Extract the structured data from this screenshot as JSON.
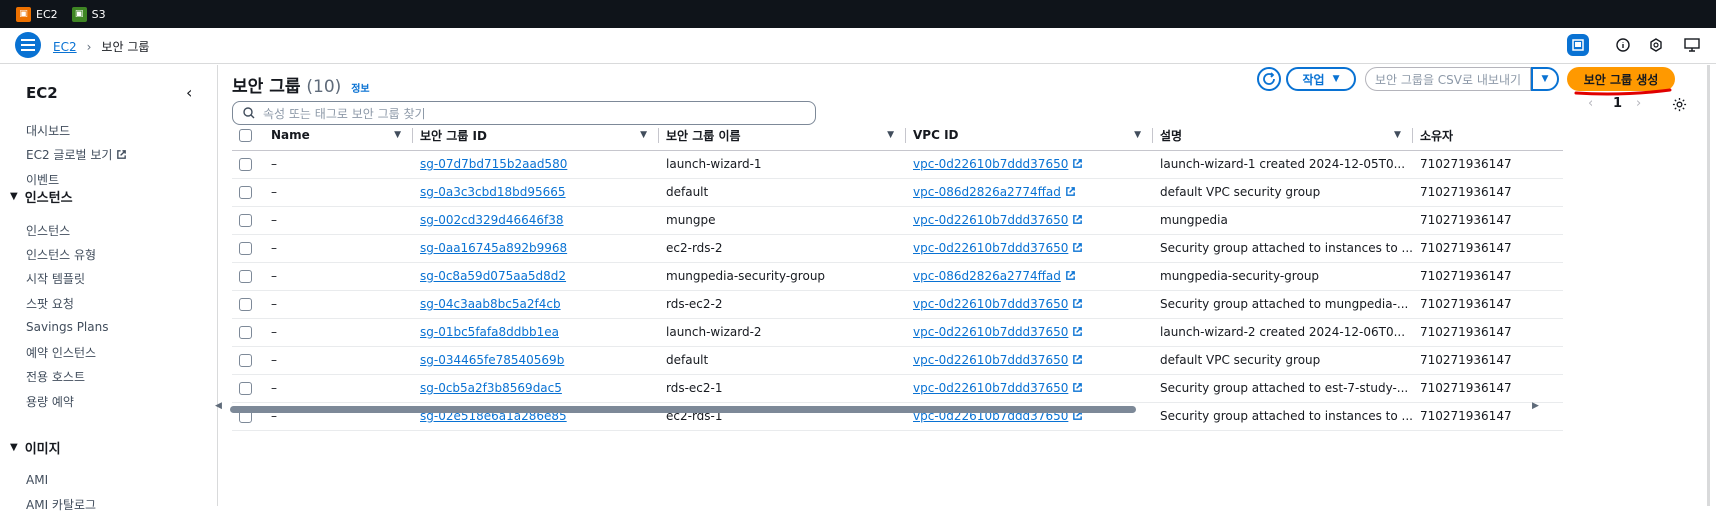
{
  "topbar": {
    "services": [
      {
        "label": "EC2",
        "color": "#ed7100",
        "icon": "ec2-icon"
      },
      {
        "label": "S3",
        "color": "#3f8624",
        "icon": "s3-icon"
      }
    ]
  },
  "breadcrumb": {
    "parent": "EC2",
    "current": "보안 그룹"
  },
  "sidebar": {
    "title": "EC2",
    "top_items": [
      "대시보드",
      "EC2 글로벌 보기",
      "이벤트"
    ],
    "section_instances": "인스턴스",
    "instance_items": [
      "인스턴스",
      "인스턴스 유형",
      "시작 템플릿",
      "스팟 요청",
      "Savings Plans",
      "예약 인스턴스",
      "전용 호스트",
      "용량 예약"
    ],
    "section_images": "이미지",
    "image_items": [
      "AMI",
      "AMI 카탈로그"
    ]
  },
  "page": {
    "title": "보안 그룹",
    "count": "(10)",
    "info": "정보",
    "actions_label": "작업",
    "export_label": "보안 그룹을 CSV로 내보내기",
    "create_label": "보안 그룹 생성",
    "search_placeholder": "속성 또는 태그로 보안 그룹 찾기",
    "page_number": "1"
  },
  "table": {
    "headers": [
      "Name",
      "보안 그룹 ID",
      "보안 그룹 이름",
      "VPC ID",
      "설명",
      "소유자"
    ],
    "rows": [
      {
        "name": "–",
        "id": "sg-07d7bd715b2aad580",
        "sgname": "launch-wizard-1",
        "vpc": "vpc-0d22610b7ddd37650",
        "desc": "launch-wizard-1 created 2024-12-05T0...",
        "owner": "710271936147"
      },
      {
        "name": "–",
        "id": "sg-0a3c3cbd18bd95665",
        "sgname": "default",
        "vpc": "vpc-086d2826a2774ffad",
        "desc": "default VPC security group",
        "owner": "710271936147"
      },
      {
        "name": "–",
        "id": "sg-002cd329d46646f38",
        "sgname": "mungpe",
        "vpc": "vpc-0d22610b7ddd37650",
        "desc": "mungpedia",
        "owner": "710271936147"
      },
      {
        "name": "–",
        "id": "sg-0aa16745a892b9968",
        "sgname": "ec2-rds-2",
        "vpc": "vpc-0d22610b7ddd37650",
        "desc": "Security group attached to instances to ...",
        "owner": "710271936147"
      },
      {
        "name": "–",
        "id": "sg-0c8a59d075aa5d8d2",
        "sgname": "mungpedia-security-group",
        "vpc": "vpc-086d2826a2774ffad",
        "desc": "mungpedia-security-group",
        "owner": "710271936147"
      },
      {
        "name": "–",
        "id": "sg-04c3aab8bc5a2f4cb",
        "sgname": "rds-ec2-2",
        "vpc": "vpc-0d22610b7ddd37650",
        "desc": "Security group attached to mungpedia-...",
        "owner": "710271936147"
      },
      {
        "name": "–",
        "id": "sg-01bc5fafa8ddbb1ea",
        "sgname": "launch-wizard-2",
        "vpc": "vpc-0d22610b7ddd37650",
        "desc": "launch-wizard-2 created 2024-12-06T0...",
        "owner": "710271936147"
      },
      {
        "name": "–",
        "id": "sg-034465fe78540569b",
        "sgname": "default",
        "vpc": "vpc-0d22610b7ddd37650",
        "desc": "default VPC security group",
        "owner": "710271936147"
      },
      {
        "name": "–",
        "id": "sg-0cb5a2f3b8569dac5",
        "sgname": "rds-ec2-1",
        "vpc": "vpc-0d22610b7ddd37650",
        "desc": "Security group attached to est-7-study-...",
        "owner": "710271936147"
      },
      {
        "name": "–",
        "id": "sg-02e518e6a1a286e85",
        "sgname": "ec2-rds-1",
        "vpc": "vpc-0d22610b7ddd37650",
        "desc": "Security group attached to instances to ...",
        "owner": "710271936147"
      }
    ]
  },
  "colors": {
    "accent": "#0972d3",
    "primary_button": "#ff9900",
    "topbar": "#0f141a",
    "annotation": "#e00000"
  }
}
